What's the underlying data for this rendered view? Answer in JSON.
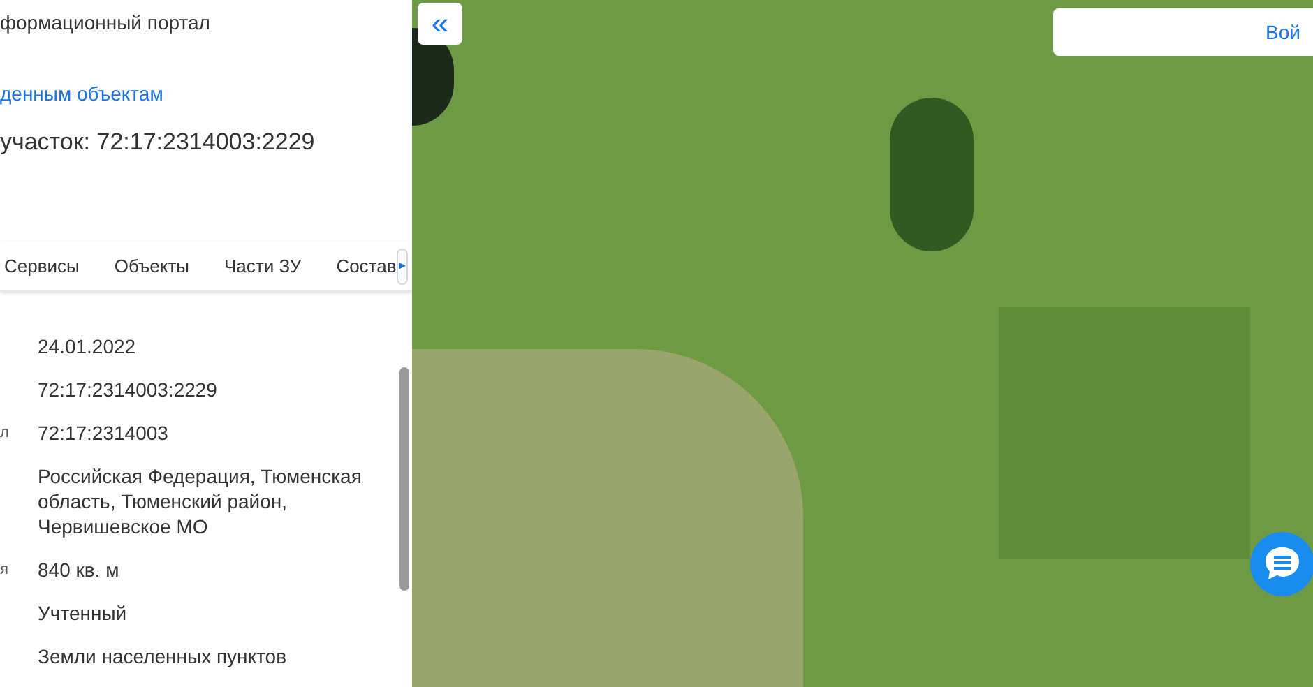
{
  "header": {
    "title": "формационный портал"
  },
  "back_link": "денным объектам",
  "heading": "участок: 72:17:2314003:2229",
  "tabs": [
    {
      "label": "Сервисы"
    },
    {
      "label": "Объекты"
    },
    {
      "label": "Части ЗУ"
    },
    {
      "label": "Состав"
    }
  ],
  "tab_scroll": "▸",
  "rows": [
    {
      "value": "24.01.2022"
    },
    {
      "value": "72:17:2314003:2229"
    },
    {
      "label": "л",
      "value": "72:17:2314003"
    },
    {
      "value": "Российская Федерация, Тюменская область, Тюменский район, Червишевское МО"
    },
    {
      "label": "я",
      "value": "840 кв. м"
    },
    {
      "value": "Учтенный"
    },
    {
      "value": "Земли населенных пунктов"
    }
  ],
  "map": {
    "collapse_button": "«",
    "login_button": "Вой"
  }
}
